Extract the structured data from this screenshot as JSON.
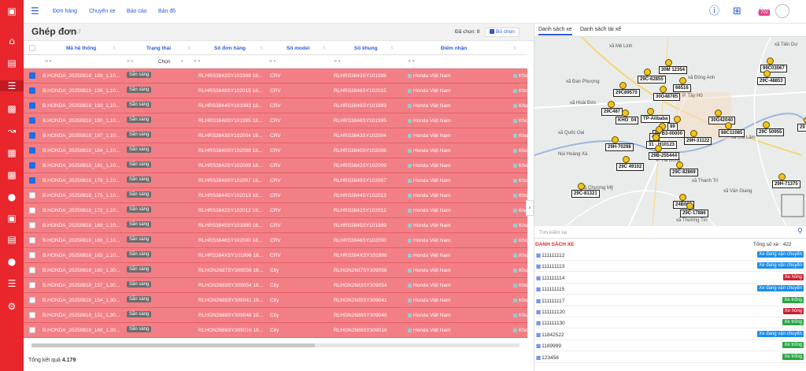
{
  "sidebar": {
    "icons": [
      "app-logo-icon",
      "home-icon",
      "document-icon",
      "barcode-icon",
      "car-icon",
      "chart-icon",
      "invoice-icon",
      "truck-icon",
      "user-icon",
      "money-icon",
      "print-icon",
      "users-icon",
      "menu-list-icon",
      "settings-icon"
    ]
  },
  "topnav": {
    "links": [
      "Đơn hàng",
      "Chuyến xe",
      "Báo cáo",
      "Bản đồ"
    ],
    "notification_count": "702"
  },
  "page": {
    "title": "Ghép đơn",
    "selected_count": "Đã chọn: 8",
    "unselect_label": "Bỏ chọn",
    "total_label": "Tổng kết quả",
    "total_value": "4.179"
  },
  "table": {
    "columns": [
      "Mã hệ thống",
      "Trạng thái",
      "Số đơn hàng",
      "Số model",
      "Số khung",
      "Điểm nhận"
    ],
    "status_filter": "Chọn",
    "rows": [
      {
        "checked": true,
        "code": "B.HONDA_20250818_199_1,10...",
        "status": "Sẵn sàng",
        "order": "RLHRS3843SY101998 18...",
        "model": "CRV",
        "frame": "RLHRS3843SY101998",
        "pickup": "Honda Việt Nam",
        "dest": "Kho"
      },
      {
        "checked": true,
        "code": "B.HONDA_20250818_196_1,10...",
        "status": "Sẵn sàng",
        "order": "RLHRS3848SY102015 18...",
        "model": "CRV",
        "frame": "RLHRS3848SY102015",
        "pickup": "Honda Việt Nam",
        "dest": "Kho"
      },
      {
        "checked": true,
        "code": "B.HONDA_20250818_193_1,10...",
        "status": "Sẵn sàng",
        "order": "RLHRS3844SY101993 18...",
        "model": "CRV",
        "frame": "RLHRS3848SY101993",
        "pickup": "Honda Việt Nam",
        "dest": "Kho"
      },
      {
        "checked": true,
        "code": "B.HONDA_20250818_190_1,10...",
        "status": "Sẵn sàng",
        "order": "RLHRS3848SY101995 18...",
        "model": "CRV",
        "frame": "RLHRS3848SY101995",
        "pickup": "Honda Việt Nam",
        "dest": "Kho"
      },
      {
        "checked": true,
        "code": "B.HONDA_20250818_187_1,10...",
        "status": "Sẵn sàng",
        "order": "RLHRS3843SY102004 18...",
        "model": "CRV",
        "frame": "RLHRS3843SY102004",
        "pickup": "Honda Việt Nam",
        "dest": "Kho"
      },
      {
        "checked": true,
        "code": "B.HONDA_20250818_184_1,10...",
        "status": "Sẵn sàng",
        "order": "RLHRS3840SY102008 18...",
        "model": "CRV",
        "frame": "RLHRS3840SY102008",
        "pickup": "Honda Việt Nam",
        "dest": "Kho"
      },
      {
        "checked": true,
        "code": "B.HONDA_20250818_181_1,10...",
        "status": "Sẵn sàng",
        "order": "RLHRS3842SY102009 18...",
        "model": "CRV",
        "frame": "RLHRS3842SY102009",
        "pickup": "Honda Việt Nam",
        "dest": "Kho"
      },
      {
        "checked": true,
        "code": "B.HONDA_20250818_178_1,10...",
        "status": "Sẵn sàng",
        "order": "RLHRS3849SY102007 18...",
        "model": "CRV",
        "frame": "RLHRS3849SY102007",
        "pickup": "Honda Việt Nam",
        "dest": "Kho"
      },
      {
        "checked": false,
        "code": "B.HONDA_20250818_175_1,10...",
        "status": "Sẵn sàng",
        "order": "RLHRS3844SY102013 18...",
        "model": "CRV",
        "frame": "RLHRS3844SY102013",
        "pickup": "Honda Việt Nam",
        "dest": "Kho"
      },
      {
        "checked": false,
        "code": "B.HONDA_20250818_172_1,10...",
        "status": "Sẵn sàng",
        "order": "RLHRS3842SY102012 18...",
        "model": "CRV",
        "frame": "RLHRS3842SY102012",
        "pickup": "Honda Việt Nam",
        "dest": "Kho"
      },
      {
        "checked": false,
        "code": "B.HONDA_20250818_169_1,10...",
        "status": "Sẵn sàng",
        "order": "RLHRS3845SY101999 18...",
        "model": "CRV",
        "frame": "RLHRS3845SY101999",
        "pickup": "Honda Việt Nam",
        "dest": "Kho"
      },
      {
        "checked": false,
        "code": "B.HONDA_20250818_166_1,10...",
        "status": "Sẵn sàng",
        "order": "RLHRS3846SY102000 18...",
        "model": "CRV",
        "frame": "RLHRS3846SY102000",
        "pickup": "Honda Việt Nam",
        "dest": "Kho"
      },
      {
        "checked": false,
        "code": "B.HONDA_20250818_163_1,10...",
        "status": "Sẵn sàng",
        "order": "RLHRS384XSY101996 18...",
        "model": "CRV",
        "frame": "RLHRS384XSY101996",
        "pickup": "Honda Việt Nam",
        "dest": "Kho"
      },
      {
        "checked": false,
        "code": "B.HONDA_20250818_160_1,30...",
        "status": "Sẵn sàng",
        "order": "RLHGN2687SY309056 18...",
        "model": "City",
        "frame": "RLHGN2687SY309056",
        "pickup": "Honda Việt Nam",
        "dest": "Kho"
      },
      {
        "checked": false,
        "code": "B.HONDA_20250818_157_1,30...",
        "status": "Sẵn sàng",
        "order": "RLHGN2683SY309054 18...",
        "model": "City",
        "frame": "RLHGN2683SY309054",
        "pickup": "Honda Việt Nam",
        "dest": "Kho"
      },
      {
        "checked": false,
        "code": "B.HONDA_20250818_154_1,30...",
        "status": "Sẵn sàng",
        "order": "RLHGN2685SY309041 18...",
        "model": "City",
        "frame": "RLHGN2685SY309041",
        "pickup": "Honda Việt Nam",
        "dest": "Kho"
      },
      {
        "checked": false,
        "code": "B.HONDA_20250818_151_1,30...",
        "status": "Sẵn sàng",
        "order": "RLHGN2688SY309048 18...",
        "model": "City",
        "frame": "RLHGN2688SY309048",
        "pickup": "Honda Việt Nam",
        "dest": "Kho"
      },
      {
        "checked": false,
        "code": "B.HONDA_20250818_148_1,30...",
        "status": "Sẵn sàng",
        "order": "RLHGN2686SY309016 18...",
        "model": "City",
        "frame": "RLHGN2686SY309016",
        "pickup": "Honda Việt Nam",
        "dest": "Kho"
      }
    ]
  },
  "right_panel": {
    "tabs": [
      "Danh sách xe",
      "Danh sách tài xế"
    ],
    "search_placeholder": "Tìm kiếm xe",
    "list_title": "DANH SÁCH XE",
    "list_total": "Tổng số xe : 422",
    "vehicles": [
      {
        "plate": "111111112",
        "status": "Xe đang vận chuyển",
        "color": "#1a8ee8"
      },
      {
        "plate": "111111113",
        "status": "Xe đang vận chuyển",
        "color": "#1a8ee8"
      },
      {
        "plate": "111111114",
        "status": "Xe hỏng",
        "color": "#c82333"
      },
      {
        "plate": "111111115",
        "status": "Xe đang vận chuyển",
        "color": "#1a8ee8"
      },
      {
        "plate": "111111117",
        "status": "Xe trống",
        "color": "#28a745"
      },
      {
        "plate": "111111120",
        "status": "Xe hỏng",
        "color": "#c82333"
      },
      {
        "plate": "111111130",
        "status": "Xe trống",
        "color": "#28a745"
      },
      {
        "plate": "11842522",
        "status": "Xe đang vận chuyển",
        "color": "#1a8ee8"
      },
      {
        "plate": "1189999",
        "status": "Xe trống",
        "color": "#28a745"
      },
      {
        "plate": "123456",
        "status": "Xe trống",
        "color": "#28a745"
      }
    ]
  },
  "map": {
    "places": [
      "xã Mê Linh",
      "xã Tiến Dư",
      "xã Đan Phượng",
      "xã Đông Anh",
      "xã Hoài Đức",
      "P. Tây Hồ",
      "xã Quốc Oai",
      "xã Gia Lâm",
      "P. Hà Đông",
      "xã Thanh Trì",
      "xã Chương Mỹ",
      "xã Văn Giang",
      "xã Thường Tín",
      "Núi Hoàng Xá"
    ],
    "plates": [
      "30M 12354",
      "99C03067",
      "29C-62855",
      "29C-48853",
      "29C89570",
      "66516",
      "30G48785",
      "29C487",
      "KHO_04",
      "TP-Alibaba",
      "30G42040",
      "29C 50955",
      "89",
      "88C11085",
      "98-B3-00000",
      "43",
      "29H-31122",
      "31 - H10123",
      "29H-70298",
      "29B-255444",
      "29C 49102",
      "29C-82869",
      "29H-71375",
      "29C-81321",
      "24B000",
      "29C-17886",
      "29"
    ]
  }
}
